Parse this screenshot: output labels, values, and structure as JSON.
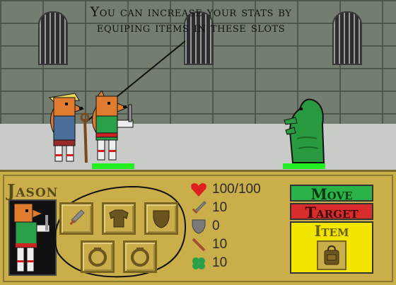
{
  "tutorial": {
    "caption_line1": "You can increase your stats by",
    "caption_line2": "equiping items in these slots"
  },
  "character": {
    "name": "Jason"
  },
  "slots": [
    {
      "name": "weapon-slot",
      "icon": "sword-icon"
    },
    {
      "name": "armor-slot",
      "icon": "chest-armor-icon"
    },
    {
      "name": "shield-slot",
      "icon": "shield-icon"
    },
    {
      "name": "ring-slot-1",
      "icon": "ring-icon"
    },
    {
      "name": "ring-slot-2",
      "icon": "ring-icon"
    }
  ],
  "stats": {
    "health": "100/100",
    "attack": "10",
    "defense": "0",
    "magic": "10",
    "luck": "10"
  },
  "actions": {
    "move": "Move",
    "target": "Target",
    "item": "Item"
  },
  "colors": {
    "move": "#2bb34a",
    "target": "#d92c2c",
    "item": "#f2e600",
    "panel": "#c9ae4a",
    "hp": "#22ee22"
  }
}
